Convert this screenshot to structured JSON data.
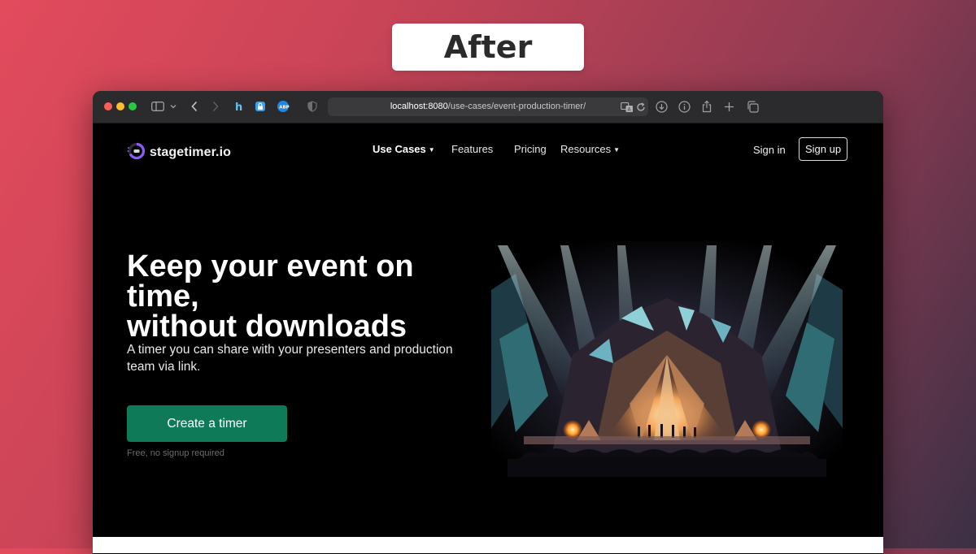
{
  "overlay": {
    "label": "After"
  },
  "browser": {
    "url_host": "localhost:8080",
    "url_path": "/use-cases/event-production-timer/",
    "icons": [
      "sidebar-icon",
      "chevron-down-icon",
      "back-icon",
      "forward-icon",
      "honey-extension-icon",
      "lock-extension-icon",
      "adblock-extension-icon",
      "shield-icon",
      "translate-icon",
      "reload-icon",
      "download-icon",
      "info-icon",
      "share-icon",
      "new-tab-icon",
      "tabs-overview-icon"
    ]
  },
  "site": {
    "brand": "stagetimer.io",
    "nav": {
      "use_cases": "Use Cases",
      "features": "Features",
      "pricing": "Pricing",
      "resources": "Resources"
    },
    "sign_in": "Sign in",
    "sign_up": "Sign up"
  },
  "hero": {
    "headline_line1": "Keep your event on time,",
    "headline_line2": "without downloads",
    "subtext": "A timer you can share with your presenters and production team via link.",
    "cta": "Create a timer",
    "fine_print": "Free, no signup required"
  },
  "colors": {
    "cta": "#0f7a57",
    "brand_accent": "#8b5cf6",
    "page_bg": "#000000"
  }
}
